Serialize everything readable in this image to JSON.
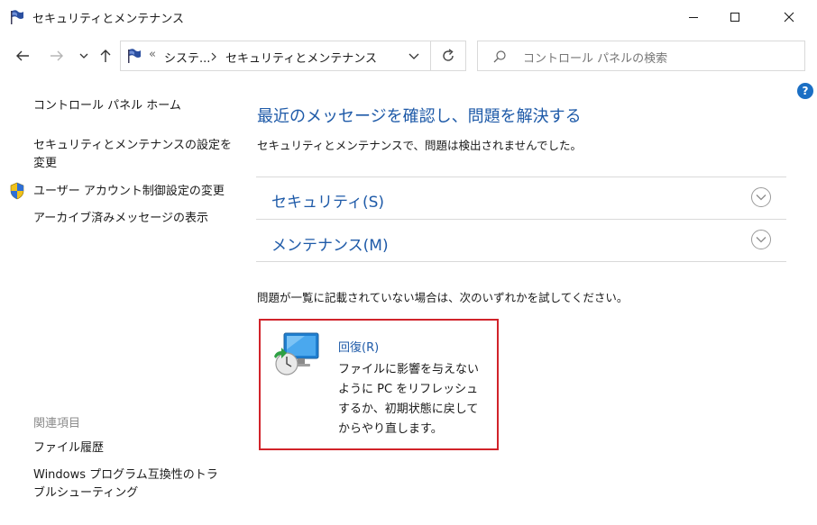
{
  "window": {
    "title": "セキュリティとメンテナンス"
  },
  "address": {
    "breadcrumb": [
      "システ...",
      "セキュリティとメンテナンス"
    ],
    "overflow_marker": "«"
  },
  "search": {
    "placeholder": "コントロール パネルの検索"
  },
  "sidebar": {
    "home": "コントロール パネル ホーム",
    "settings_line1": "セキュリティとメンテナンスの設定を",
    "settings_line2": "変更",
    "uac": "ユーザー アカウント制御設定の変更",
    "archive": "アーカイブ済みメッセージの表示",
    "related_heading": "関連項目",
    "file_history": "ファイル履歴",
    "compat_line1": "Windows プログラム互換性のトラ",
    "compat_line2": "ブルシューティング"
  },
  "main": {
    "heading": "最近のメッセージを確認し、問題を解決する",
    "status": "セキュリティとメンテナンスで、問題は検出されませんでした。",
    "sections": [
      {
        "label": "セキュリティ(S)"
      },
      {
        "label": "メンテナンス(M)"
      }
    ],
    "try_text": "問題が一覧に記載されていない場合は、次のいずれかを試してください。",
    "recovery": {
      "title": "回復(R)",
      "description": "ファイルに影響を与えないように PC をリフレッシュするか、初期状態に戻してからやり直します。"
    }
  },
  "colors": {
    "accent": "#1e5aa8",
    "highlight_border": "#d1232a",
    "help": "#1b6fc4"
  },
  "icons": [
    "flag-icon",
    "minimize-icon",
    "maximize-icon",
    "close-icon",
    "back-arrow-icon",
    "forward-arrow-icon",
    "history-dropdown-icon",
    "up-arrow-icon",
    "refresh-icon",
    "search-icon",
    "help-icon",
    "uac-shield-icon",
    "chevron-down-icon",
    "recovery-icon"
  ]
}
